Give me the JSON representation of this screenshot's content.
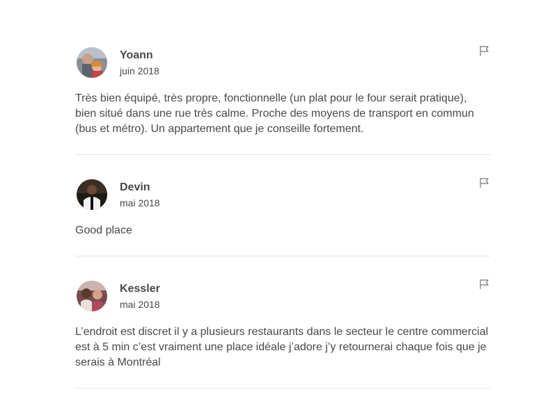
{
  "reviews": [
    {
      "name": "Yoann",
      "date": "juin 2018",
      "text": "Très bien équipé, très propre, fonctionnelle (un plat pour le four serait pratique), bien situé dans une rue très calme. Proche des moyens de transport en commun (bus et métro). Un appartement que je conseille fortement.",
      "avatar": "avatar-photo"
    },
    {
      "name": "Devin",
      "date": "mai 2018",
      "text": "Good place",
      "avatar": "avatar-photo"
    },
    {
      "name": "Kessler",
      "date": "mai 2018",
      "text": "L’endroit est discret il y a plusieurs restaurants dans le secteur le centre commercial est à 5 min c’est vraiment une place idéale j’adore j’y retournerai chaque fois que je serais à Montréal",
      "avatar": "avatar-photo"
    }
  ],
  "icons": {
    "flag": "flag-icon"
  },
  "colors": {
    "text": "#484848",
    "divider": "#e4e4e4",
    "flag": "#767676"
  }
}
